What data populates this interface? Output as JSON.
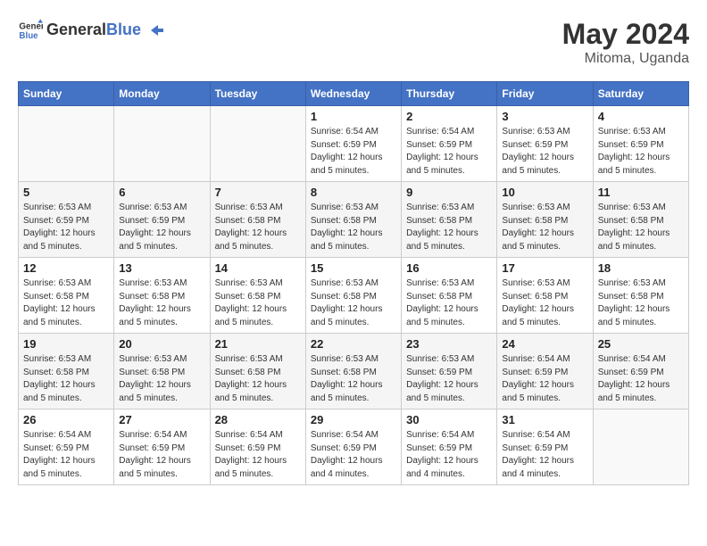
{
  "header": {
    "logo_general": "General",
    "logo_blue": "Blue",
    "month_year": "May 2024",
    "location": "Mitoma, Uganda"
  },
  "days_of_week": [
    "Sunday",
    "Monday",
    "Tuesday",
    "Wednesday",
    "Thursday",
    "Friday",
    "Saturday"
  ],
  "weeks": [
    [
      {
        "day": "",
        "info": ""
      },
      {
        "day": "",
        "info": ""
      },
      {
        "day": "",
        "info": ""
      },
      {
        "day": "1",
        "info": "Sunrise: 6:54 AM\nSunset: 6:59 PM\nDaylight: 12 hours\nand 5 minutes."
      },
      {
        "day": "2",
        "info": "Sunrise: 6:54 AM\nSunset: 6:59 PM\nDaylight: 12 hours\nand 5 minutes."
      },
      {
        "day": "3",
        "info": "Sunrise: 6:53 AM\nSunset: 6:59 PM\nDaylight: 12 hours\nand 5 minutes."
      },
      {
        "day": "4",
        "info": "Sunrise: 6:53 AM\nSunset: 6:59 PM\nDaylight: 12 hours\nand 5 minutes."
      }
    ],
    [
      {
        "day": "5",
        "info": "Sunrise: 6:53 AM\nSunset: 6:59 PM\nDaylight: 12 hours\nand 5 minutes."
      },
      {
        "day": "6",
        "info": "Sunrise: 6:53 AM\nSunset: 6:59 PM\nDaylight: 12 hours\nand 5 minutes."
      },
      {
        "day": "7",
        "info": "Sunrise: 6:53 AM\nSunset: 6:58 PM\nDaylight: 12 hours\nand 5 minutes."
      },
      {
        "day": "8",
        "info": "Sunrise: 6:53 AM\nSunset: 6:58 PM\nDaylight: 12 hours\nand 5 minutes."
      },
      {
        "day": "9",
        "info": "Sunrise: 6:53 AM\nSunset: 6:58 PM\nDaylight: 12 hours\nand 5 minutes."
      },
      {
        "day": "10",
        "info": "Sunrise: 6:53 AM\nSunset: 6:58 PM\nDaylight: 12 hours\nand 5 minutes."
      },
      {
        "day": "11",
        "info": "Sunrise: 6:53 AM\nSunset: 6:58 PM\nDaylight: 12 hours\nand 5 minutes."
      }
    ],
    [
      {
        "day": "12",
        "info": "Sunrise: 6:53 AM\nSunset: 6:58 PM\nDaylight: 12 hours\nand 5 minutes."
      },
      {
        "day": "13",
        "info": "Sunrise: 6:53 AM\nSunset: 6:58 PM\nDaylight: 12 hours\nand 5 minutes."
      },
      {
        "day": "14",
        "info": "Sunrise: 6:53 AM\nSunset: 6:58 PM\nDaylight: 12 hours\nand 5 minutes."
      },
      {
        "day": "15",
        "info": "Sunrise: 6:53 AM\nSunset: 6:58 PM\nDaylight: 12 hours\nand 5 minutes."
      },
      {
        "day": "16",
        "info": "Sunrise: 6:53 AM\nSunset: 6:58 PM\nDaylight: 12 hours\nand 5 minutes."
      },
      {
        "day": "17",
        "info": "Sunrise: 6:53 AM\nSunset: 6:58 PM\nDaylight: 12 hours\nand 5 minutes."
      },
      {
        "day": "18",
        "info": "Sunrise: 6:53 AM\nSunset: 6:58 PM\nDaylight: 12 hours\nand 5 minutes."
      }
    ],
    [
      {
        "day": "19",
        "info": "Sunrise: 6:53 AM\nSunset: 6:58 PM\nDaylight: 12 hours\nand 5 minutes."
      },
      {
        "day": "20",
        "info": "Sunrise: 6:53 AM\nSunset: 6:58 PM\nDaylight: 12 hours\nand 5 minutes."
      },
      {
        "day": "21",
        "info": "Sunrise: 6:53 AM\nSunset: 6:58 PM\nDaylight: 12 hours\nand 5 minutes."
      },
      {
        "day": "22",
        "info": "Sunrise: 6:53 AM\nSunset: 6:58 PM\nDaylight: 12 hours\nand 5 minutes."
      },
      {
        "day": "23",
        "info": "Sunrise: 6:53 AM\nSunset: 6:59 PM\nDaylight: 12 hours\nand 5 minutes."
      },
      {
        "day": "24",
        "info": "Sunrise: 6:54 AM\nSunset: 6:59 PM\nDaylight: 12 hours\nand 5 minutes."
      },
      {
        "day": "25",
        "info": "Sunrise: 6:54 AM\nSunset: 6:59 PM\nDaylight: 12 hours\nand 5 minutes."
      }
    ],
    [
      {
        "day": "26",
        "info": "Sunrise: 6:54 AM\nSunset: 6:59 PM\nDaylight: 12 hours\nand 5 minutes."
      },
      {
        "day": "27",
        "info": "Sunrise: 6:54 AM\nSunset: 6:59 PM\nDaylight: 12 hours\nand 5 minutes."
      },
      {
        "day": "28",
        "info": "Sunrise: 6:54 AM\nSunset: 6:59 PM\nDaylight: 12 hours\nand 5 minutes."
      },
      {
        "day": "29",
        "info": "Sunrise: 6:54 AM\nSunset: 6:59 PM\nDaylight: 12 hours\nand 4 minutes."
      },
      {
        "day": "30",
        "info": "Sunrise: 6:54 AM\nSunset: 6:59 PM\nDaylight: 12 hours\nand 4 minutes."
      },
      {
        "day": "31",
        "info": "Sunrise: 6:54 AM\nSunset: 6:59 PM\nDaylight: 12 hours\nand 4 minutes."
      },
      {
        "day": "",
        "info": ""
      }
    ]
  ]
}
